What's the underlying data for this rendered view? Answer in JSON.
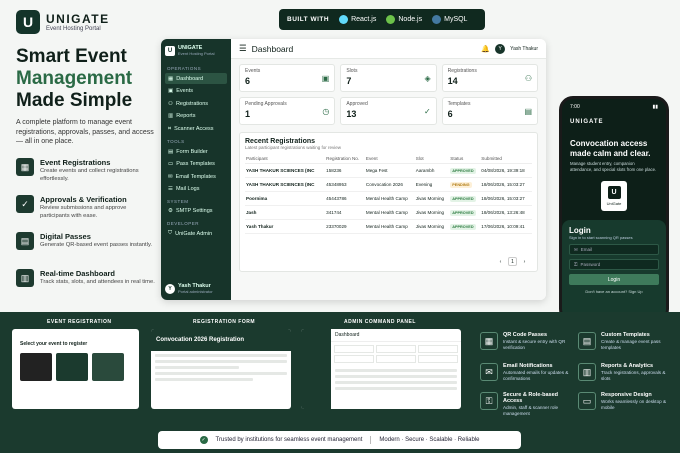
{
  "brand": {
    "mark": "U",
    "name": "UNIGATE",
    "tagline": "Event Hosting Portal"
  },
  "built_with": {
    "label": "BUILT WITH",
    "tech": [
      "React.js",
      "Node.js",
      "MySQL"
    ]
  },
  "hero": {
    "line1": "Smart Event",
    "line2": "Management",
    "line3": "Made Simple",
    "desc": "A complete platform to manage event registrations, approvals, passes, and access — all in one place."
  },
  "features": [
    {
      "icon": "▦",
      "title": "Event Registrations",
      "desc": "Create events and collect registrations effortlessly."
    },
    {
      "icon": "✓",
      "title": "Approvals & Verification",
      "desc": "Review submissions and approve participants with ease."
    },
    {
      "icon": "▤",
      "title": "Digital Passes",
      "desc": "Generate QR-based event passes instantly."
    },
    {
      "icon": "▥",
      "title": "Real-time Dashboard",
      "desc": "Track stats, slots, and attendees in real time."
    }
  ],
  "sidebar": {
    "brand": "UNIGATE",
    "brand_sub": "Event Hosting Portal",
    "sections": {
      "operations": "OPERATIONS",
      "tools": "TOOLS",
      "system": "SYSTEM",
      "developer": "DEVELOPER"
    },
    "items": {
      "dashboard": "Dashboard",
      "events": "Events",
      "registrations": "Registrations",
      "reports": "Reports",
      "scanner": "Scanner Access",
      "form_builder": "Form Builder",
      "pass_templates": "Pass Templates",
      "email_templates": "Email Templates",
      "mail_logs": "Mail Logs",
      "smtp": "SMTP Settings",
      "admin": "UniGate Admin"
    },
    "user": {
      "initial": "Y",
      "name": "Yash Thakur",
      "role": "Portal administrator"
    }
  },
  "topbar": {
    "title": "Dashboard",
    "user_initial": "Y",
    "user_name": "Yash Thakur"
  },
  "stats": [
    {
      "label": "Events",
      "value": "6",
      "icon": "▣"
    },
    {
      "label": "Slots",
      "value": "7",
      "icon": "◈"
    },
    {
      "label": "Registrations",
      "value": "14",
      "icon": "⚇"
    },
    {
      "label": "Pending Approvals",
      "value": "1",
      "icon": "◷"
    },
    {
      "label": "Approved",
      "value": "13",
      "icon": "✓"
    },
    {
      "label": "Templates",
      "value": "6",
      "icon": "▤"
    }
  ],
  "recent": {
    "title": "Recent Registrations",
    "sub": "Latest participant registrations waiting for review",
    "columns": [
      "Participant",
      "Registration No.",
      "Event",
      "Slot",
      "Status",
      "Submitted"
    ],
    "rows": [
      [
        "YASH THAKUR SCIENCES (INC",
        "158236",
        "Mega Fest",
        "Aarambh",
        "APPROVED",
        "04/08/2026, 19:39:18"
      ],
      [
        "YASH THAKUR SCIENCES (INC",
        "45348953",
        "Convocation 2026",
        "Evening",
        "PENDING",
        "18/06/2026, 15:03:27"
      ],
      [
        "Poornima",
        "45443786",
        "Mental Health Camp",
        "Jivas Morning",
        "APPROVED",
        "18/06/2026, 15:03:27"
      ],
      [
        "Jash",
        "341744",
        "Mental Health Camp",
        "Jivas Morning",
        "APPROVED",
        "18/06/2026, 13:26:48"
      ],
      [
        "Yash Thakur",
        "23370029",
        "Mental Health Camp",
        "Jivas Morning",
        "APPROVED",
        "17/06/2026, 10:09:41"
      ]
    ],
    "page": "1"
  },
  "phone": {
    "time": "7:00",
    "brand": "UNIGATE",
    "headline": "Convocation access made calm and clear.",
    "desc": "Manage student entry, companion attendance, and special slots from one place.",
    "logo_text": "UniGate",
    "login_title": "Login",
    "login_sub": "Sign in to start scanning QR passes",
    "email_ph": "Email",
    "password_ph": "Password",
    "login_btn": "Login",
    "footer": "Don't have an account? Sign Up"
  },
  "band": {
    "labels": [
      "EVENT REGISTRATION",
      "REGISTRATION FORM",
      "ADMIN COMMAND PANEL"
    ],
    "reg_title": "Select your event to register",
    "form_title": "Convocation 2026 Registration",
    "admin_title": "Dashboard",
    "features": [
      {
        "icon": "▦",
        "title": "QR Code Passes",
        "desc": "Instant & secure entry with QR verification"
      },
      {
        "icon": "✉",
        "title": "Email Notifications",
        "desc": "Automated emails for updates & confirmations"
      },
      {
        "icon": "⚿",
        "title": "Secure & Role-based Access",
        "desc": "Admin, staff & scanner role management"
      },
      {
        "icon": "▤",
        "title": "Custom Templates",
        "desc": "Create & manage event pass templates"
      },
      {
        "icon": "▥",
        "title": "Reports & Analytics",
        "desc": "Track registrations, approvals & slots"
      },
      {
        "icon": "▭",
        "title": "Responsive Design",
        "desc": "Works seamlessly on desktop & mobile"
      }
    ]
  },
  "trust": {
    "text": "Trusted by institutions for seamless event management",
    "tags": "Modern · Secure · Scalable · Reliable"
  }
}
